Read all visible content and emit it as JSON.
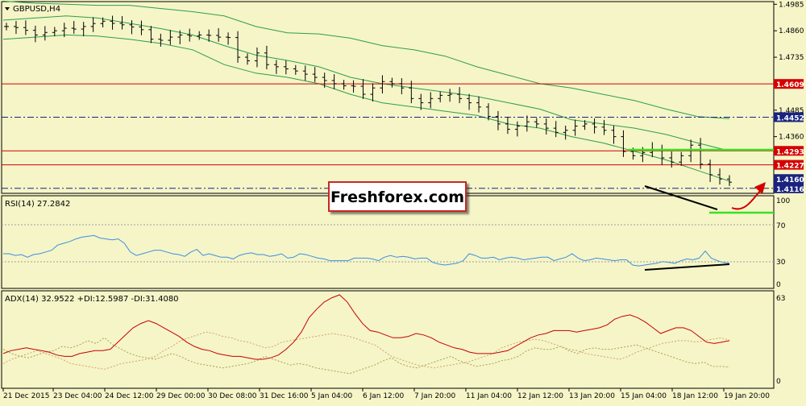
{
  "window": {
    "title": "GBPUSD,H4"
  },
  "watermark": {
    "text": "Freshforex.com"
  },
  "colors": {
    "background": "#f5f5c8",
    "panel_border": "#000000",
    "bollinger": "#2e9e4a",
    "resistance_line": "#d40000",
    "support_dashdot": "#1a237e",
    "highlight_green": "#39e21f",
    "trend_black": "#000000",
    "forecast_arrow": "#d40000",
    "rsi": "#3d8fe0",
    "rsi_level": "#a0a0a0",
    "adx": "#c80000",
    "plus_di": "#a8a24a",
    "minus_di": "#d8a26a",
    "label_red_bg": "#d40000",
    "label_blue_bg": "#1a237e",
    "watermark_border": "#c62828"
  },
  "chart_data": [
    {
      "type": "line",
      "name": "GBPUSD H4 price",
      "title": "GBPUSD,H4",
      "x_ticks": [
        "21 Dec 2015",
        "23 Dec 04:00",
        "24 Dec 12:00",
        "29 Dec 00:00",
        "30 Dec 08:00",
        "31 Dec 16:00",
        "5 Jan 04:00",
        "6 Jan 12:00",
        "7 Jan 20:00",
        "11 Jan 04:00",
        "12 Jan 12:00",
        "13 Jan 20:00",
        "15 Jan 04:00",
        "18 Jan 12:00",
        "19 Jan 20:00"
      ],
      "y_ticks": [
        "1.4985",
        "1.4860",
        "1.4735",
        "1.4485",
        "1.4360"
      ],
      "ylim": [
        1.41,
        1.499
      ],
      "price_series": [
        {
          "name": "close",
          "values": [
            1.488,
            1.4875,
            1.4862,
            1.484,
            1.4852,
            1.486,
            1.4872,
            1.4868,
            1.488,
            1.4894,
            1.4905,
            1.4895,
            1.4888,
            1.4878,
            1.4865,
            1.482,
            1.4815,
            1.483,
            1.484,
            1.4835,
            1.484,
            1.4838,
            1.483,
            1.4828,
            1.4735,
            1.4718,
            1.4755,
            1.47,
            1.469,
            1.468,
            1.467,
            1.4655,
            1.464,
            1.4625,
            1.461,
            1.46,
            1.4598,
            1.456,
            1.459,
            1.462,
            1.461,
            1.459,
            1.454,
            1.452,
            1.454,
            1.4555,
            1.456,
            1.454,
            1.452,
            1.45,
            1.4455,
            1.442,
            1.4395,
            1.441,
            1.443,
            1.442,
            1.44,
            1.438,
            1.439,
            1.441,
            1.442,
            1.4405,
            1.439,
            1.436,
            1.429,
            1.427,
            1.4285,
            1.43,
            1.426,
            1.424,
            1.427,
            1.432,
            1.423,
            1.418,
            1.416,
            1.4145
          ]
        },
        {
          "name": "bollinger_upper",
          "values": [
            1.5,
            1.499,
            1.4985,
            1.498,
            1.498,
            1.4965,
            1.495,
            1.493,
            1.488,
            1.485,
            1.4845,
            1.4825,
            1.479,
            1.477,
            1.474,
            1.469,
            1.465,
            1.461,
            1.459,
            1.456,
            1.453,
            1.449,
            1.4455,
            1.4445
          ]
        },
        {
          "name": "bollinger_middle",
          "values": [
            1.491,
            1.492,
            1.493,
            1.492,
            1.4895,
            1.487,
            1.484,
            1.479,
            1.4745,
            1.472,
            1.469,
            1.464,
            1.461,
            1.459,
            1.457,
            1.455,
            1.452,
            1.449,
            1.444,
            1.442,
            1.44,
            1.437,
            1.433,
            1.4293
          ]
        },
        {
          "name": "bollinger_lower",
          "values": [
            1.482,
            1.483,
            1.484,
            1.4835,
            1.482,
            1.48,
            1.477,
            1.47,
            1.466,
            1.464,
            1.461,
            1.456,
            1.452,
            1.45,
            1.448,
            1.446,
            1.442,
            1.44,
            1.436,
            1.433,
            1.429,
            1.425,
            1.42,
            1.415
          ]
        }
      ],
      "levels": [
        {
          "price": 1.4609,
          "label": "1.4609",
          "style": "solid",
          "color": "#d40000"
        },
        {
          "price": 1.4452,
          "label": "1.4452",
          "style": "dashdot",
          "color": "#1a237e"
        },
        {
          "price": 1.4293,
          "label": "1.4293",
          "style": "solid",
          "color": "#d40000"
        },
        {
          "price": 1.4227,
          "label": "1.4227",
          "style": "solid",
          "color": "#d40000"
        },
        {
          "price": 1.4116,
          "label": "1.4116",
          "style": "dashdot",
          "color": "#1a237e"
        }
      ],
      "current_price": {
        "label": "1.4160",
        "price": 1.416
      }
    },
    {
      "type": "line",
      "title": "RSI(14) 27.2842",
      "name": "RSI(14)",
      "value": 27.2842,
      "ylim": [
        0,
        100
      ],
      "y_ticks": [
        "100",
        "70",
        "30",
        "0"
      ],
      "levels": [
        70,
        30
      ],
      "values": [
        38,
        38,
        36,
        37,
        34,
        37,
        38,
        40,
        42,
        48,
        50,
        52,
        55,
        57,
        58,
        59,
        56,
        55,
        54,
        55,
        50,
        40,
        36,
        38,
        40,
        42,
        42,
        40,
        38,
        37,
        35,
        40,
        43,
        36,
        38,
        36,
        34,
        34,
        32,
        36,
        38,
        39,
        37,
        37,
        35,
        36,
        38,
        33,
        34,
        38,
        37,
        35,
        33,
        32,
        30,
        30,
        30,
        30,
        33,
        33,
        33,
        32,
        30,
        34,
        36,
        34,
        35,
        34,
        32,
        33,
        33,
        28,
        26,
        25,
        26,
        27,
        30,
        38,
        36,
        33,
        33,
        34,
        31,
        33,
        34,
        33,
        31,
        32,
        33,
        34,
        34,
        30,
        32,
        34,
        38,
        33,
        30,
        31,
        33,
        32,
        31,
        30,
        31,
        31,
        25,
        24,
        25,
        26,
        27,
        29,
        28,
        27,
        30,
        32,
        31,
        33,
        41,
        33,
        30,
        28,
        27
      ]
    },
    {
      "type": "line",
      "title": "ADX(14) 32.9522 +DI:12.5987 -DI:31.4080",
      "ylim": [
        0,
        63
      ],
      "y_ticks": [
        "63",
        "0"
      ],
      "series": [
        {
          "name": "ADX(14)",
          "value": 32.9522,
          "values": [
            22,
            24,
            25,
            26,
            25,
            24,
            23,
            21,
            20,
            20,
            22,
            23,
            24,
            24,
            25,
            30,
            35,
            40,
            43,
            45,
            43,
            40,
            37,
            34,
            30,
            27,
            25,
            24,
            22,
            21,
            20,
            20,
            19,
            18,
            18,
            19,
            21,
            25,
            30,
            37,
            47,
            53,
            58,
            61,
            63,
            58,
            50,
            43,
            38,
            37,
            35,
            33,
            33,
            34,
            36,
            35,
            33,
            30,
            28,
            26,
            25,
            23,
            22,
            22,
            22,
            23,
            24,
            27,
            30,
            33,
            35,
            36,
            38,
            38,
            38,
            37,
            38,
            39,
            40,
            42,
            46,
            48,
            49,
            47,
            44,
            40,
            36,
            38,
            40,
            40,
            38,
            34,
            30,
            29,
            30,
            31
          ]
        },
        {
          "name": "+DI",
          "value": 12.5987,
          "values": [
            25,
            22,
            20,
            19,
            21,
            23,
            24,
            27,
            26,
            28,
            31,
            29,
            33,
            28,
            25,
            22,
            20,
            19,
            18,
            20,
            22,
            20,
            17,
            15,
            14,
            13,
            12,
            13,
            14,
            15,
            17,
            20,
            18,
            16,
            14,
            15,
            14,
            12,
            11,
            10,
            9,
            8,
            10,
            12,
            14,
            17,
            19,
            15,
            13,
            12,
            14,
            16,
            18,
            20,
            17,
            15,
            13,
            14,
            15,
            17,
            18,
            20,
            24,
            26,
            25,
            25,
            27,
            24,
            22,
            25,
            26,
            25,
            25,
            26,
            27,
            28,
            26,
            24,
            22,
            20,
            18,
            16,
            15,
            16,
            13,
            13,
            12.5987
          ]
        },
        {
          "name": "-DI",
          "value": 31.408,
          "values": [
            15,
            18,
            20,
            22,
            24,
            22,
            20,
            18,
            15,
            14,
            13,
            12,
            11,
            13,
            15,
            16,
            17,
            18,
            20,
            24,
            27,
            31,
            33,
            35,
            37,
            36,
            34,
            33,
            31,
            30,
            28,
            26,
            27,
            30,
            31,
            32,
            33,
            34,
            35,
            36,
            35,
            34,
            32,
            30,
            28,
            24,
            20,
            18,
            16,
            14,
            13,
            12,
            13,
            14,
            15,
            16,
            18,
            20,
            22,
            26,
            28,
            30,
            31,
            32,
            31,
            29,
            27,
            25,
            24,
            22,
            21,
            20,
            19,
            18,
            20,
            23,
            25,
            27,
            29,
            30,
            31,
            31,
            30,
            31,
            32,
            33,
            31.408
          ]
        }
      ]
    }
  ]
}
